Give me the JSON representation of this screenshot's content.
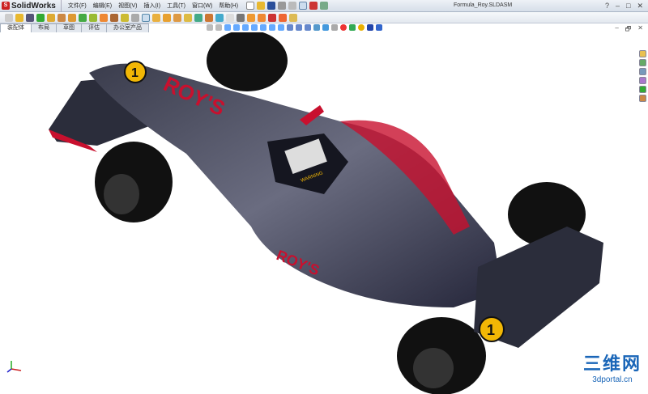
{
  "app": {
    "name": "SolidWorks",
    "document_title": "Formula_Roy.SLDASM"
  },
  "menu": [
    "文件(F)",
    "编辑(E)",
    "视图(V)",
    "插入(I)",
    "工具(T)",
    "窗口(W)",
    "帮助(H)"
  ],
  "window_controls": {
    "help": "?",
    "minimize": "–",
    "maximize": "□",
    "close": "✕"
  },
  "viewport_controls": {
    "minimize": "–",
    "restore": "🗗",
    "close": "✕"
  },
  "tabs": [
    {
      "label": "装配体",
      "active": true
    },
    {
      "label": "布局"
    },
    {
      "label": "草图"
    },
    {
      "label": "评估"
    },
    {
      "label": "办公室产品"
    }
  ],
  "model": {
    "decal_text": "ROY'S",
    "number": "1",
    "warning": "WARNING"
  },
  "watermark": {
    "title": "三维网",
    "url": "3dportal.cn"
  },
  "colors": {
    "accent": "#c8102e",
    "body": "#2a2c3a",
    "yellow": "#f2b705"
  }
}
